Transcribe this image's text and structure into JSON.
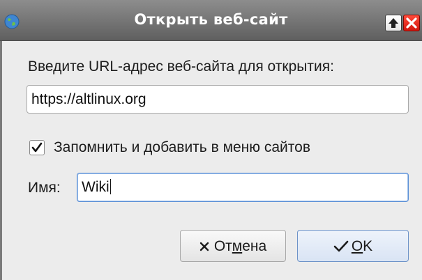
{
  "window": {
    "title": "Открыть веб-сайт"
  },
  "dialog": {
    "prompt": "Введите URL-адрес веб-сайта для открытия:",
    "url_value": "https://altlinux.org",
    "remember": {
      "checked": true,
      "label": "Запомнить и добавить в меню сайтов"
    },
    "name_label": "Имя:",
    "name_value": "Wiki"
  },
  "buttons": {
    "cancel": {
      "pre": "От",
      "mnemonic": "м",
      "post": "ена"
    },
    "ok": {
      "pre": "",
      "mnemonic": "O",
      "post": "K"
    }
  },
  "colors": {
    "accent": "#5b8fd6",
    "close": "#d2140c"
  }
}
